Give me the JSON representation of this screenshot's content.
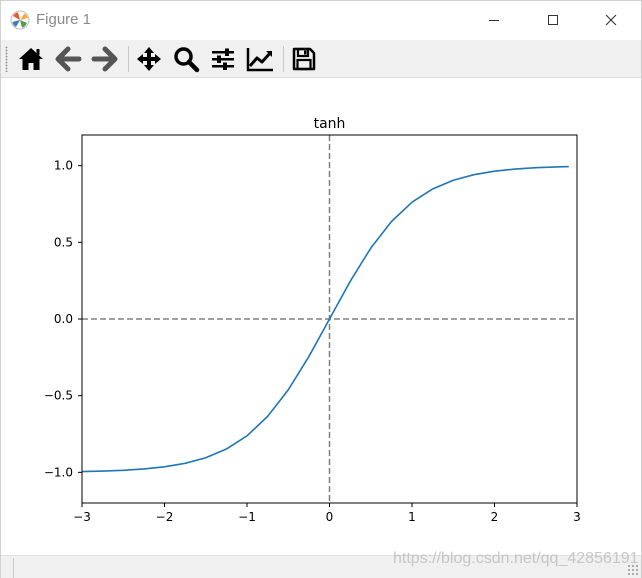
{
  "window": {
    "title": "Figure 1",
    "app_icon": "matplotlib-logo-icon",
    "controls": [
      "minimize-icon",
      "maximize-icon",
      "close-icon"
    ]
  },
  "toolbar": {
    "tools": [
      {
        "name": "home",
        "icon": "home-icon"
      },
      {
        "name": "back",
        "icon": "arrow-left-icon"
      },
      {
        "name": "forward",
        "icon": "arrow-right-icon"
      },
      {
        "name": "pan",
        "icon": "move-icon"
      },
      {
        "name": "zoom",
        "icon": "magnifier-icon"
      },
      {
        "name": "subplots",
        "icon": "sliders-icon"
      },
      {
        "name": "customize",
        "icon": "line-chart-icon"
      },
      {
        "name": "save",
        "icon": "floppy-disk-icon"
      }
    ]
  },
  "chart_data": {
    "type": "line",
    "title": "tanh",
    "xlabel": "",
    "ylabel": "",
    "xlim": [
      -3,
      3
    ],
    "ylim": [
      -1.2,
      1.2
    ],
    "x_ticks": [
      -3,
      -2,
      -1,
      0,
      1,
      2,
      3
    ],
    "x_tick_labels": [
      "−3",
      "−2",
      "−1",
      "0",
      "1",
      "2",
      "3"
    ],
    "y_ticks": [
      -1.0,
      -0.5,
      0.0,
      0.5,
      1.0
    ],
    "y_tick_labels": [
      "−1.0",
      "−0.5",
      "0.0",
      "0.5",
      "1.0"
    ],
    "grid": false,
    "series": [
      {
        "color": "#1f77b4",
        "x": [
          -3.0,
          -2.75,
          -2.5,
          -2.25,
          -2.0,
          -1.75,
          -1.5,
          -1.25,
          -1.0,
          -0.75,
          -0.5,
          -0.25,
          0.0,
          0.25,
          0.5,
          0.75,
          1.0,
          1.25,
          1.5,
          1.75,
          2.0,
          2.25,
          2.5,
          2.75,
          2.9
        ],
        "y": [
          -0.995,
          -0.992,
          -0.987,
          -0.978,
          -0.964,
          -0.941,
          -0.905,
          -0.848,
          -0.762,
          -0.635,
          -0.462,
          -0.245,
          0.0,
          0.245,
          0.462,
          0.635,
          0.762,
          0.848,
          0.905,
          0.941,
          0.964,
          0.978,
          0.987,
          0.992,
          0.994
        ]
      }
    ],
    "reference_lines": [
      {
        "orientation": "horizontal",
        "value": 0,
        "style": "dashed",
        "color": "#808080"
      },
      {
        "orientation": "vertical",
        "value": 0,
        "style": "dashed",
        "color": "#808080"
      }
    ]
  },
  "watermark": "https://blog.csdn.net/qq_42856191"
}
